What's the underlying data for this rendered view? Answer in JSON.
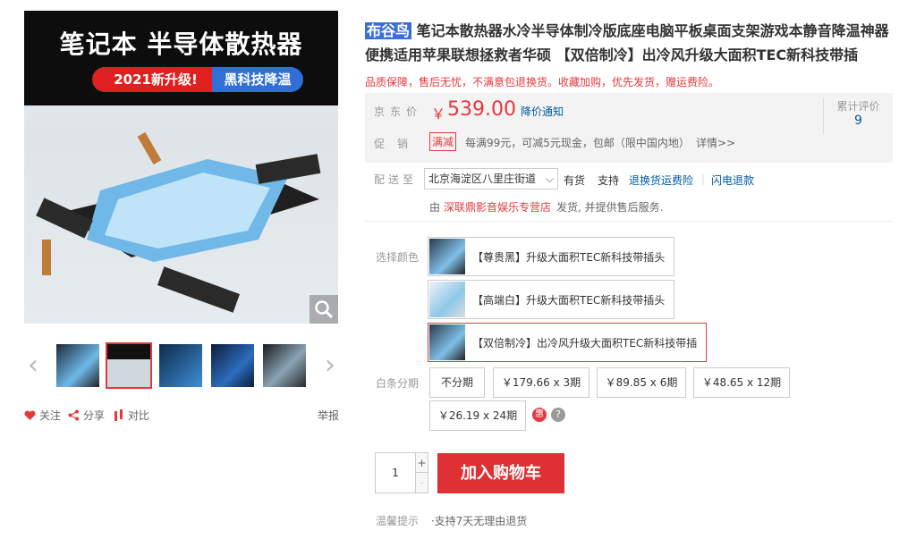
{
  "gallery": {
    "headline": "笔记本 半导体散热器",
    "badge_left": "2021新升级!",
    "badge_right": "黑科技降温",
    "thumbnails": 5
  },
  "actions": {
    "follow": "关注",
    "share": "分享",
    "compare": "对比",
    "report": "举报"
  },
  "product": {
    "brand": "布谷鸟",
    "title_rest": "笔记本散热器水冷半导体制冷版底座电脑平板桌面支架游戏本静音降温神器便携适用苹果联想拯救者华硕 【双倍制冷】出冷风升级大面积TEC新科技带插",
    "slogan": "品质保障，售后无忧，不满意包退换货。收藏加购，优先发货，赠运费险。"
  },
  "price_box": {
    "price_label": "京东价",
    "currency": "￥",
    "price": "539.00",
    "price_notice": "降价通知",
    "reviews_label": "累计评价",
    "reviews_count": "9",
    "promo_label": "促销",
    "promo_tag": "满减",
    "promo_text": "每满99元，可减5元现金，包邮（限中国内地）",
    "promo_more": "详情>>"
  },
  "delivery": {
    "label": "配送至",
    "address": "北京海淀区八里庄街道",
    "stock": "有货",
    "support_label": "支持",
    "service1": "退换货运费险",
    "service2": "闪电退款",
    "seller_prefix": "由",
    "seller": "深联鼎影音娱乐专营店",
    "seller_suffix": "发货, 并提供售后服务."
  },
  "colors": {
    "label": "选择颜色",
    "options": [
      "【尊贵黑】升级大面积TEC新科技带插头",
      "【高端白】升级大面积TEC新科技带插头",
      "【双倍制冷】出冷风升级大面积TEC新科技带插"
    ],
    "selected_index": 2
  },
  "installment": {
    "label": "白条分期",
    "options": [
      "不分期",
      "￥179.66 x 3期",
      "￥89.85 x 6期",
      "￥48.65 x 12期",
      "￥26.19 x 24期"
    ],
    "hui_badge": "惠",
    "help_badge": "?"
  },
  "purchase": {
    "quantity": "1",
    "plus": "+",
    "minus": "-",
    "add_to_cart": "加入购物车"
  },
  "tips": {
    "label": "温馨提示",
    "value": "·支持7天无理由退货"
  },
  "theme": {
    "accent_red": "#e4393c",
    "link_blue": "#005aa0",
    "brand_highlight": "#3c6ed7"
  }
}
